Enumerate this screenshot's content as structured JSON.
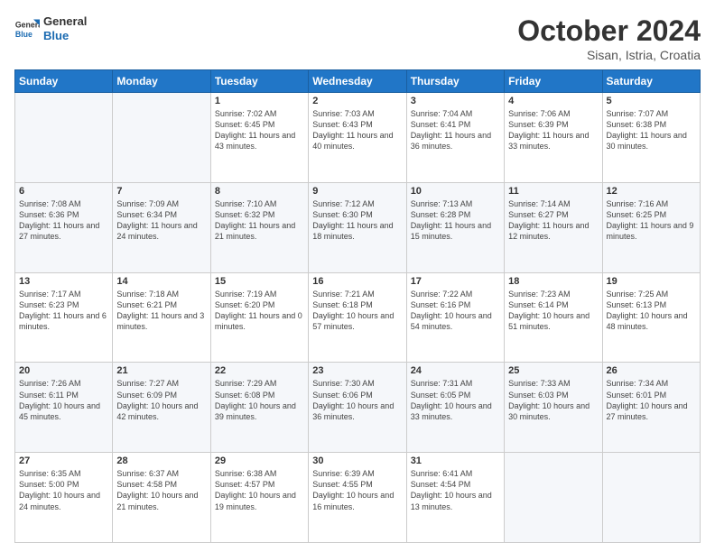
{
  "header": {
    "logo_general": "General",
    "logo_blue": "Blue",
    "month": "October 2024",
    "location": "Sisan, Istria, Croatia"
  },
  "weekdays": [
    "Sunday",
    "Monday",
    "Tuesday",
    "Wednesday",
    "Thursday",
    "Friday",
    "Saturday"
  ],
  "weeks": [
    [
      {
        "day": "",
        "info": ""
      },
      {
        "day": "",
        "info": ""
      },
      {
        "day": "1",
        "info": "Sunrise: 7:02 AM\nSunset: 6:45 PM\nDaylight: 11 hours and 43 minutes."
      },
      {
        "day": "2",
        "info": "Sunrise: 7:03 AM\nSunset: 6:43 PM\nDaylight: 11 hours and 40 minutes."
      },
      {
        "day": "3",
        "info": "Sunrise: 7:04 AM\nSunset: 6:41 PM\nDaylight: 11 hours and 36 minutes."
      },
      {
        "day": "4",
        "info": "Sunrise: 7:06 AM\nSunset: 6:39 PM\nDaylight: 11 hours and 33 minutes."
      },
      {
        "day": "5",
        "info": "Sunrise: 7:07 AM\nSunset: 6:38 PM\nDaylight: 11 hours and 30 minutes."
      }
    ],
    [
      {
        "day": "6",
        "info": "Sunrise: 7:08 AM\nSunset: 6:36 PM\nDaylight: 11 hours and 27 minutes."
      },
      {
        "day": "7",
        "info": "Sunrise: 7:09 AM\nSunset: 6:34 PM\nDaylight: 11 hours and 24 minutes."
      },
      {
        "day": "8",
        "info": "Sunrise: 7:10 AM\nSunset: 6:32 PM\nDaylight: 11 hours and 21 minutes."
      },
      {
        "day": "9",
        "info": "Sunrise: 7:12 AM\nSunset: 6:30 PM\nDaylight: 11 hours and 18 minutes."
      },
      {
        "day": "10",
        "info": "Sunrise: 7:13 AM\nSunset: 6:28 PM\nDaylight: 11 hours and 15 minutes."
      },
      {
        "day": "11",
        "info": "Sunrise: 7:14 AM\nSunset: 6:27 PM\nDaylight: 11 hours and 12 minutes."
      },
      {
        "day": "12",
        "info": "Sunrise: 7:16 AM\nSunset: 6:25 PM\nDaylight: 11 hours and 9 minutes."
      }
    ],
    [
      {
        "day": "13",
        "info": "Sunrise: 7:17 AM\nSunset: 6:23 PM\nDaylight: 11 hours and 6 minutes."
      },
      {
        "day": "14",
        "info": "Sunrise: 7:18 AM\nSunset: 6:21 PM\nDaylight: 11 hours and 3 minutes."
      },
      {
        "day": "15",
        "info": "Sunrise: 7:19 AM\nSunset: 6:20 PM\nDaylight: 11 hours and 0 minutes."
      },
      {
        "day": "16",
        "info": "Sunrise: 7:21 AM\nSunset: 6:18 PM\nDaylight: 10 hours and 57 minutes."
      },
      {
        "day": "17",
        "info": "Sunrise: 7:22 AM\nSunset: 6:16 PM\nDaylight: 10 hours and 54 minutes."
      },
      {
        "day": "18",
        "info": "Sunrise: 7:23 AM\nSunset: 6:14 PM\nDaylight: 10 hours and 51 minutes."
      },
      {
        "day": "19",
        "info": "Sunrise: 7:25 AM\nSunset: 6:13 PM\nDaylight: 10 hours and 48 minutes."
      }
    ],
    [
      {
        "day": "20",
        "info": "Sunrise: 7:26 AM\nSunset: 6:11 PM\nDaylight: 10 hours and 45 minutes."
      },
      {
        "day": "21",
        "info": "Sunrise: 7:27 AM\nSunset: 6:09 PM\nDaylight: 10 hours and 42 minutes."
      },
      {
        "day": "22",
        "info": "Sunrise: 7:29 AM\nSunset: 6:08 PM\nDaylight: 10 hours and 39 minutes."
      },
      {
        "day": "23",
        "info": "Sunrise: 7:30 AM\nSunset: 6:06 PM\nDaylight: 10 hours and 36 minutes."
      },
      {
        "day": "24",
        "info": "Sunrise: 7:31 AM\nSunset: 6:05 PM\nDaylight: 10 hours and 33 minutes."
      },
      {
        "day": "25",
        "info": "Sunrise: 7:33 AM\nSunset: 6:03 PM\nDaylight: 10 hours and 30 minutes."
      },
      {
        "day": "26",
        "info": "Sunrise: 7:34 AM\nSunset: 6:01 PM\nDaylight: 10 hours and 27 minutes."
      }
    ],
    [
      {
        "day": "27",
        "info": "Sunrise: 6:35 AM\nSunset: 5:00 PM\nDaylight: 10 hours and 24 minutes."
      },
      {
        "day": "28",
        "info": "Sunrise: 6:37 AM\nSunset: 4:58 PM\nDaylight: 10 hours and 21 minutes."
      },
      {
        "day": "29",
        "info": "Sunrise: 6:38 AM\nSunset: 4:57 PM\nDaylight: 10 hours and 19 minutes."
      },
      {
        "day": "30",
        "info": "Sunrise: 6:39 AM\nSunset: 4:55 PM\nDaylight: 10 hours and 16 minutes."
      },
      {
        "day": "31",
        "info": "Sunrise: 6:41 AM\nSunset: 4:54 PM\nDaylight: 10 hours and 13 minutes."
      },
      {
        "day": "",
        "info": ""
      },
      {
        "day": "",
        "info": ""
      }
    ]
  ]
}
